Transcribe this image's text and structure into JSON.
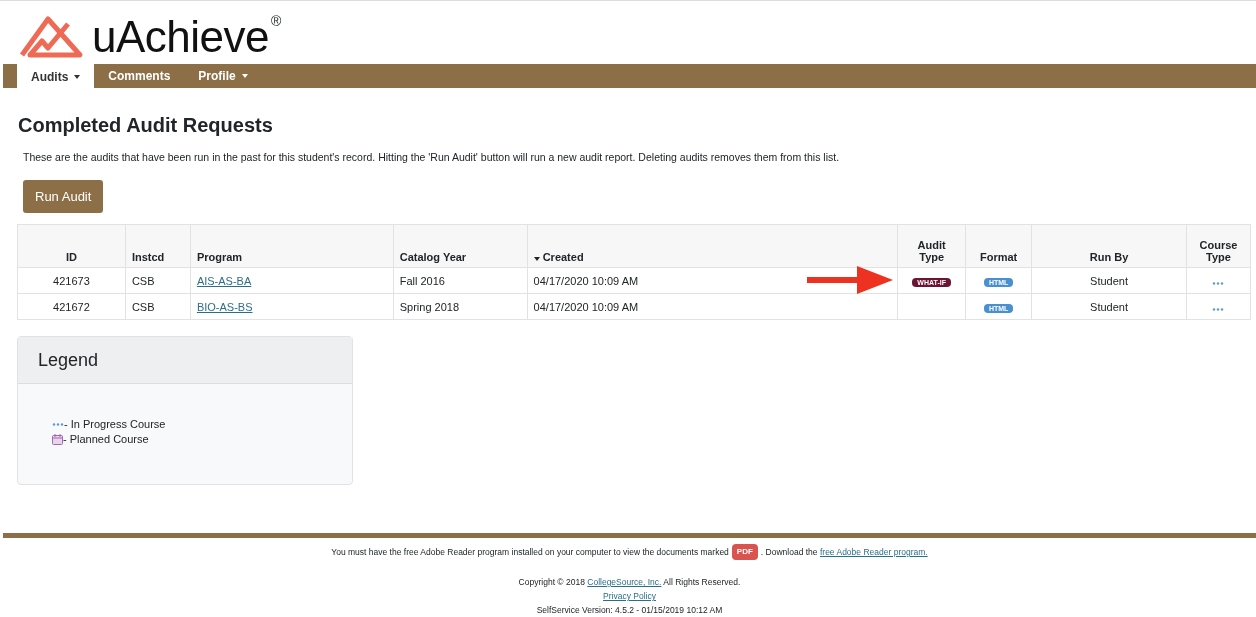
{
  "logo": {
    "text": "uAchieve",
    "mark": "®"
  },
  "nav": [
    {
      "label": "Audits",
      "dropdown": true,
      "selected": true
    },
    {
      "label": "Comments",
      "dropdown": false,
      "selected": false
    },
    {
      "label": "Profile",
      "dropdown": true,
      "selected": false
    }
  ],
  "page_title": "Completed Audit Requests",
  "description": "These are the audits that have been run in the past for this student's record. Hitting the 'Run Audit' button will run a new audit report. Deleting audits removes them from this list.",
  "run_button": "Run Audit",
  "table": {
    "columns": [
      {
        "label": "ID",
        "sorted": false
      },
      {
        "label": "Instcd",
        "sorted": false
      },
      {
        "label": "Program",
        "sorted": false
      },
      {
        "label": "Catalog Year",
        "sorted": false
      },
      {
        "label": "Created",
        "sorted": true
      },
      {
        "label": "Audit Type",
        "sorted": false
      },
      {
        "label": "Format",
        "sorted": false
      },
      {
        "label": "Run By",
        "sorted": false
      },
      {
        "label": "Course Type",
        "sorted": false
      }
    ],
    "rows": [
      {
        "id": "421673",
        "instcd": "CSB",
        "program": "AIS-AS-BA",
        "catalog_year": "Fall 2016",
        "created": "04/17/2020 10:09 AM",
        "audit_type": "WHAT-IF",
        "format": "HTML",
        "run_by": "Student",
        "annotated": true
      },
      {
        "id": "421672",
        "instcd": "CSB",
        "program": "BIO-AS-BS",
        "catalog_year": "Spring 2018",
        "created": "04/17/2020 10:09 AM",
        "format": "HTML",
        "run_by": "Student",
        "annotated": false
      }
    ]
  },
  "legend": {
    "title": "Legend",
    "items": [
      {
        "kind": "in-progress",
        "label": "- In Progress Course"
      },
      {
        "kind": "planned",
        "label": "- Planned Course"
      }
    ]
  },
  "footer": {
    "notice_before": "You must have the free Adobe Reader program installed on your computer to view the documents marked",
    "pdf_badge": "PDF",
    "notice_after": ". Download the",
    "notice_link": "free Adobe Reader program.",
    "copyright_before": "Copyright © 2018",
    "copyright_link": "CollegeSource, Inc.",
    "copyright_after": "All Rights Reserved.",
    "privacy_link": "Privacy Policy",
    "version": "SelfService Version: 4.5.2 - 01/15/2019 10:12 AM"
  }
}
